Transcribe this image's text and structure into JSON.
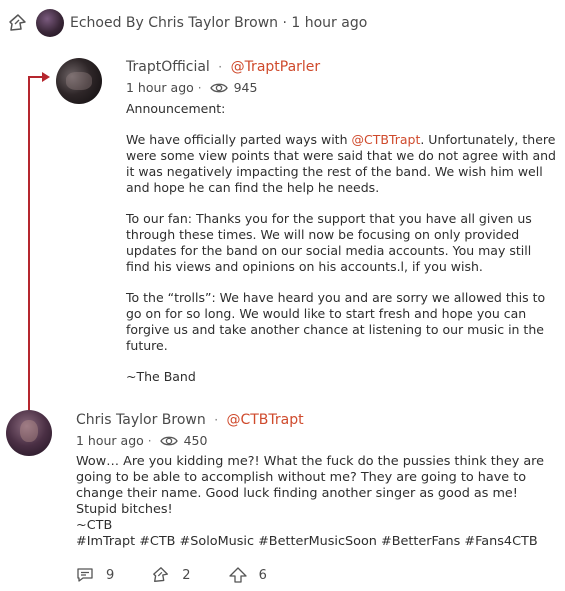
{
  "echo": {
    "text": "Echoed By Chris Taylor Brown · 1 hour ago"
  },
  "original_post": {
    "name": "TraptOfficial",
    "handle": "@TraptParler",
    "time": "1 hour ago",
    "views": "945",
    "paragraphs": {
      "p1": "Announcement:",
      "p2_before": "We have officially parted ways with ",
      "p2_mention": "@CTBTrapt",
      "p2_after": ". Unfortunately, there were some view points that were said that we do not agree with and it was negatively impacting the rest of the band. We wish him well and hope he can find the help he needs.",
      "p3": "To our fan: Thanks you for the support that you have all given us through these times. We will now be focusing on only provided updates for the band on our social media accounts. You may still find his views and opinions on his accounts.l, if you wish.",
      "p4": "To the “trolls”: We have heard you and are sorry we allowed this to go on for so long. We would like to start fresh and hope you can forgive us and take another chance at listening to our music in the future.",
      "p5": "~The Band"
    }
  },
  "echo_post": {
    "name": "Chris Taylor Brown",
    "handle": "@CTBTrapt",
    "time": "1 hour ago",
    "views": "450",
    "lines": {
      "l1": "Wow… Are you kidding me?! What the fuck do the pussies think they are going to be able to accomplish without me? They are going to have to change their name. Good luck finding another singer as good as me! Stupid bitches!",
      "l2": "~CTB",
      "l3": "#ImTrapt #CTB #SoloMusic #BetterMusicSoon #BetterFans #Fans4CTB"
    }
  },
  "actions": {
    "comments": "9",
    "echoes": "2",
    "upvotes": "6"
  }
}
